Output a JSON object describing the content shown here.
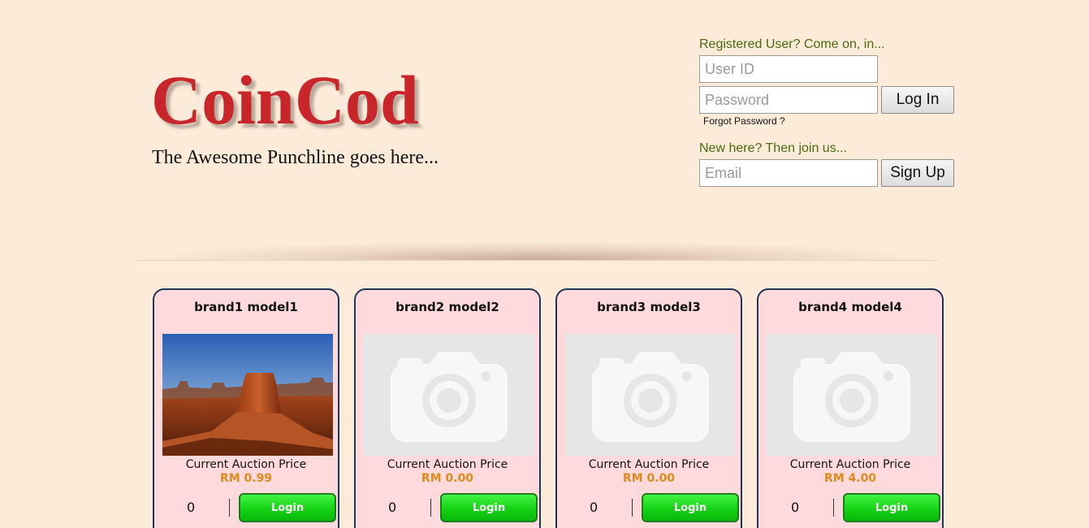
{
  "brand": {
    "logo_text": "CoinCod",
    "tagline": "The Awesome Punchline goes here..."
  },
  "login": {
    "registered_prompt": "Registered User? Come on, in...",
    "user_id_placeholder": "User ID",
    "password_placeholder": "Password",
    "login_button": "Log In",
    "forgot_password": "Forgot Password ?",
    "new_prompt": "New here? Then join us...",
    "email_placeholder": "Email",
    "signup_button": "Sign Up"
  },
  "colors": {
    "background": "#fdebd9",
    "logo": "#c8262b",
    "card_background": "#ffdadc",
    "card_border": "#1f3557",
    "price": "#e08a1e",
    "login_button": "#14d214"
  },
  "products": [
    {
      "title": "brand1 model1",
      "image": "desert-mesa-photo",
      "price_label": "Current Auction Price",
      "price": "RM 0.99",
      "bids": "0",
      "button": "Login"
    },
    {
      "title": "brand2 model2",
      "image": "camera-placeholder",
      "price_label": "Current Auction Price",
      "price": "RM 0.00",
      "bids": "0",
      "button": "Login"
    },
    {
      "title": "brand3 model3",
      "image": "camera-placeholder",
      "price_label": "Current Auction Price",
      "price": "RM 0.00",
      "bids": "0",
      "button": "Login"
    },
    {
      "title": "brand4 model4",
      "image": "camera-placeholder",
      "price_label": "Current Auction Price",
      "price": "RM 4.00",
      "bids": "0",
      "button": "Login"
    }
  ]
}
